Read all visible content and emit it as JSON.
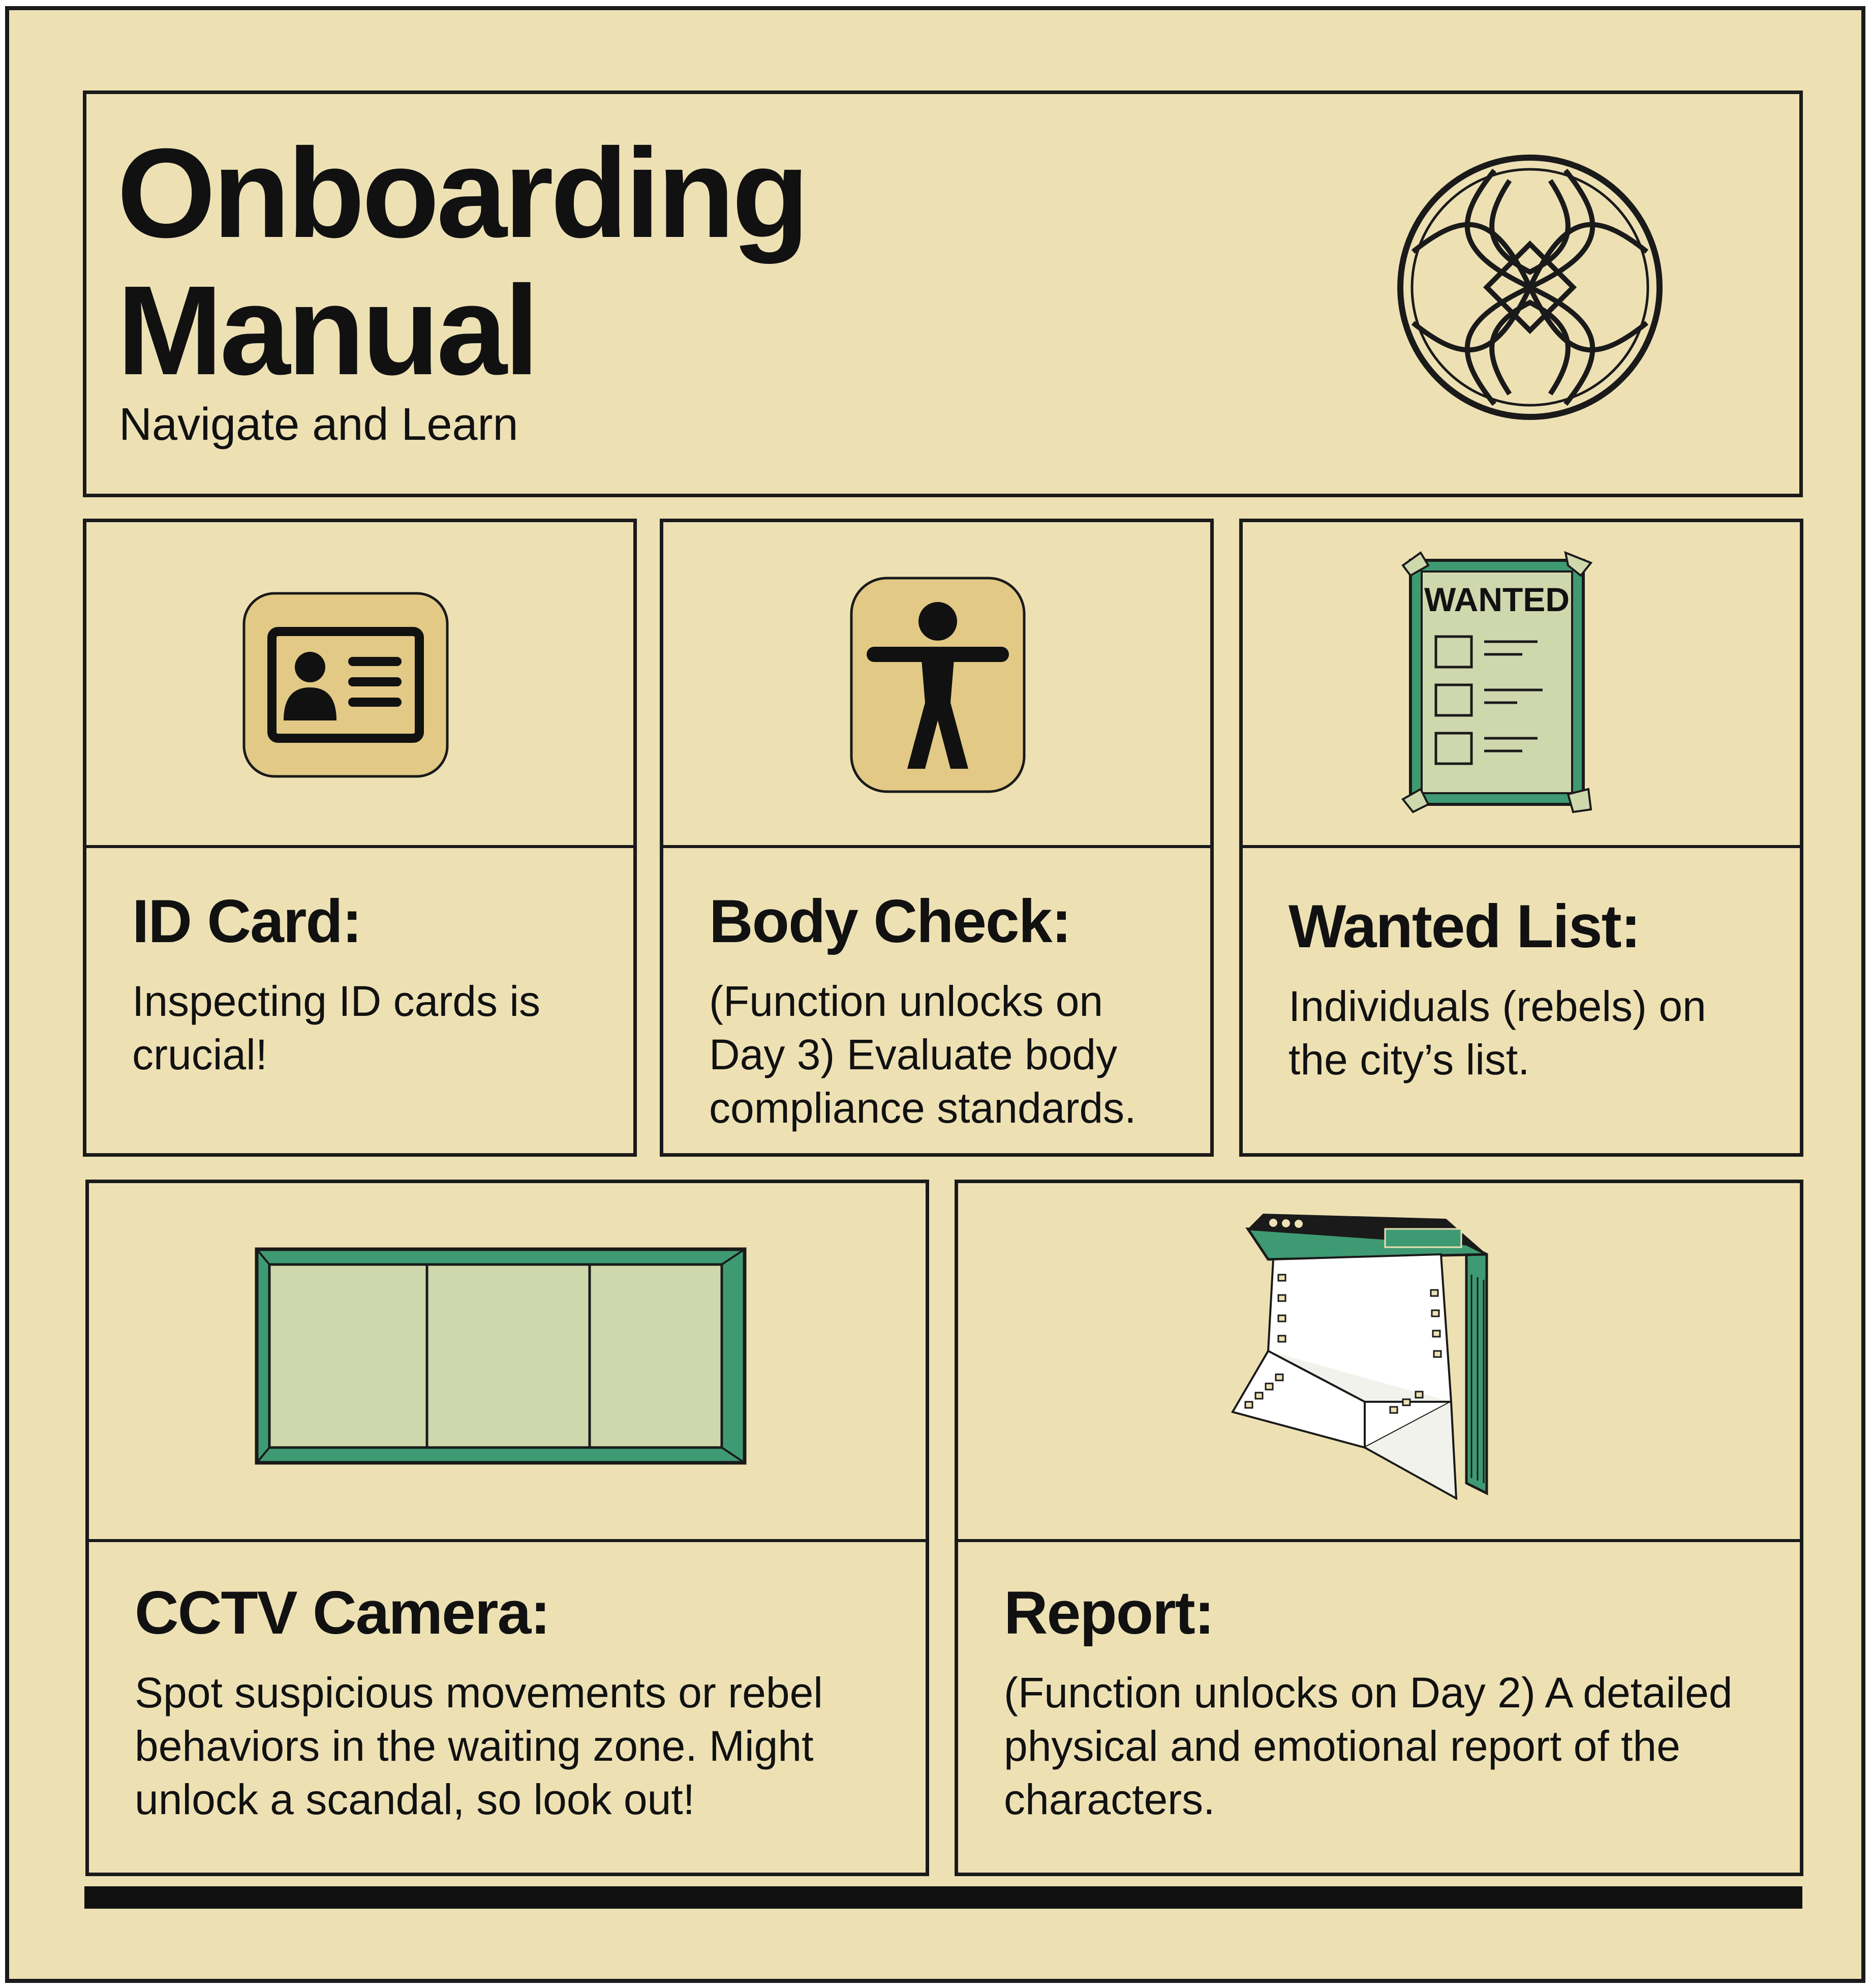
{
  "header": {
    "title_line1": "Onboarding",
    "title_line2": "Manual",
    "subtitle": "Navigate and Learn",
    "logo_icon": "knot-emblem-icon"
  },
  "cards": [
    {
      "icon": "id-card-icon",
      "title": "ID Card:",
      "description": "Inspecting ID cards is crucial!"
    },
    {
      "icon": "body-figure-icon",
      "title": "Body Check:",
      "description": "(Function unlocks on Day 3) Evaluate body compliance standards."
    },
    {
      "icon": "wanted-poster-icon",
      "icon_text": "WANTED",
      "title": "Wanted List:",
      "description": "Individuals (rebels) on the city’s list."
    },
    {
      "icon": "cctv-monitor-icon",
      "title": "CCTV Camera:",
      "description": "Spot suspicious movements or rebel behaviors in the waiting zone. Might unlock a scandal, so look out!"
    },
    {
      "icon": "report-printer-icon",
      "title": "Report:",
      "description": "(Function unlocks on Day 2) A detailed physical and emotional report of the characters."
    }
  ],
  "colors": {
    "paper": "#ede1b4",
    "ink": "#1a1a1a",
    "green": "#3e9a72",
    "pale_green": "#cfd8ad",
    "icon_tile": "#e2c985"
  }
}
